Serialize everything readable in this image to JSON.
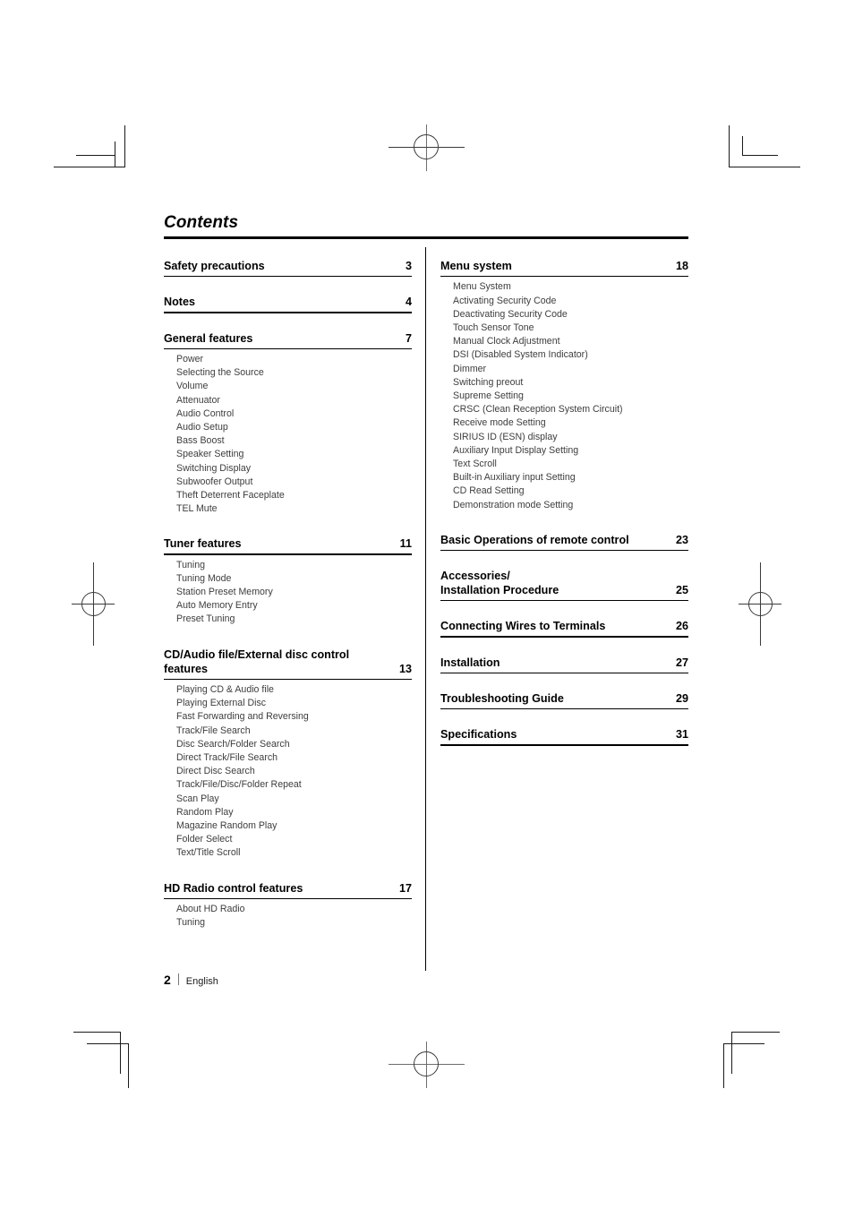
{
  "document": {
    "title": "Contents",
    "footer": {
      "page_number": "2",
      "language": "English"
    }
  },
  "left_column": [
    {
      "heading": "Safety precautions",
      "page": "3",
      "items": []
    },
    {
      "heading": "Notes",
      "page": "4",
      "items": []
    },
    {
      "heading": "General features",
      "page": "7",
      "items": [
        "Power",
        "Selecting the Source",
        "Volume",
        "Attenuator",
        "Audio Control",
        "Audio Setup",
        "Bass Boost",
        "Speaker Setting",
        "Switching Display",
        "Subwoofer Output",
        "Theft Deterrent Faceplate",
        "TEL Mute"
      ]
    },
    {
      "heading": "Tuner features",
      "page": "11",
      "items": [
        "Tuning",
        "Tuning Mode",
        "Station Preset Memory",
        "Auto Memory Entry",
        "Preset Tuning"
      ]
    },
    {
      "heading": "CD/Audio file/External disc control features",
      "heading_line1": "CD/Audio file/External disc control",
      "heading_line2": "features",
      "page": "13",
      "items": [
        "Playing CD & Audio file",
        "Playing External Disc",
        "Fast Forwarding and Reversing",
        "Track/File Search",
        "Disc Search/Folder Search",
        "Direct Track/File Search",
        "Direct Disc Search",
        "Track/File/Disc/Folder Repeat",
        "Scan Play",
        "Random Play",
        "Magazine Random Play",
        "Folder Select",
        "Text/Title Scroll"
      ]
    },
    {
      "heading": "HD Radio control features",
      "page": "17",
      "items": [
        "About HD Radio",
        "Tuning"
      ]
    }
  ],
  "right_column": [
    {
      "heading": "Menu system",
      "page": "18",
      "items": [
        "Menu System",
        "Activating Security Code",
        "Deactivating Security Code",
        "Touch Sensor Tone",
        "Manual Clock Adjustment",
        "DSI (Disabled System Indicator)",
        "Dimmer",
        "Switching preout",
        "Supreme Setting",
        "CRSC (Clean Reception System Circuit)",
        "Receive mode Setting",
        "SIRIUS ID (ESN) display",
        "Auxiliary Input Display Setting",
        "Text Scroll",
        "Built-in Auxiliary input Setting",
        "CD Read Setting",
        "Demonstration mode Setting"
      ]
    },
    {
      "heading": "Basic Operations of remote control",
      "page": "23",
      "items": []
    },
    {
      "heading": "Accessories/ Installation Procedure",
      "heading_line1": "Accessories/",
      "heading_line2": "Installation Procedure",
      "page": "25",
      "items": []
    },
    {
      "heading": "Connecting Wires to Terminals",
      "page": "26",
      "items": []
    },
    {
      "heading": "Installation",
      "page": "27",
      "items": []
    },
    {
      "heading": "Troubleshooting Guide",
      "page": "29",
      "items": []
    },
    {
      "heading": "Specifications",
      "page": "31",
      "items": []
    }
  ]
}
